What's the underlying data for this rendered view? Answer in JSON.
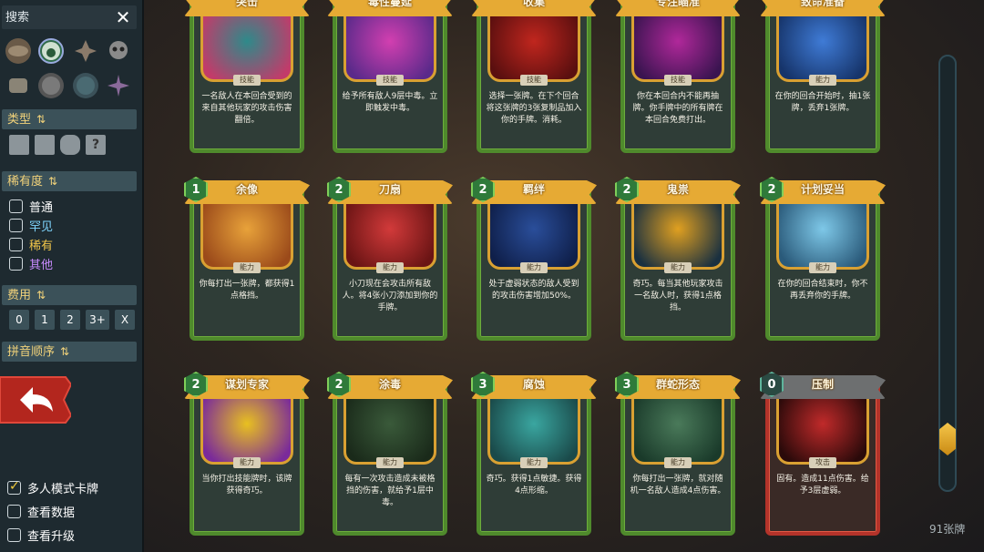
{
  "search": {
    "placeholder": "搜索"
  },
  "sections": {
    "type": "类型",
    "rarity": "稀有度",
    "cost": "费用",
    "pinyin": "拼音顺序"
  },
  "rarity_options": [
    {
      "label": "普通",
      "color": "#ffffff",
      "checked": false
    },
    {
      "label": "罕见",
      "color": "#7fd6ff",
      "checked": false
    },
    {
      "label": "稀有",
      "color": "#f2c64a",
      "checked": false
    },
    {
      "label": "其他",
      "color": "#c98bff",
      "checked": false
    }
  ],
  "cost_filters": [
    "0",
    "1",
    "2",
    "3+",
    "X"
  ],
  "bottom_options": [
    {
      "label": "多人模式卡牌",
      "checked": true
    },
    {
      "label": "查看数据",
      "checked": false
    },
    {
      "label": "查看升级",
      "checked": false
    }
  ],
  "card_count": "91张牌",
  "cards_row1": [
    {
      "title": "突击",
      "cost": "",
      "type": "技能",
      "desc": "一名敌人在本回合受到的来自其他玩家的攻击伤害翻倍。",
      "art": [
        "#2e8a8a",
        "#c23b6a"
      ]
    },
    {
      "title": "毒性蔓延",
      "cost": "",
      "type": "技能",
      "desc": "给予所有敌人9层中毒。立即触发中毒。",
      "art": [
        "#d23fb0",
        "#5a2a8a"
      ]
    },
    {
      "title": "收集",
      "cost": "",
      "type": "技能",
      "desc": "选择一张牌。在下个回合将这张牌的3张复制品加入你的手牌。消耗。",
      "art": [
        "#c0261e",
        "#5a0f0f"
      ]
    },
    {
      "title": "专注瞄准",
      "cost": "",
      "type": "技能",
      "desc": "你在本回合内不能再抽牌。你手牌中的所有牌在本回合免费打出。",
      "art": [
        "#b0289a",
        "#3a1450"
      ]
    },
    {
      "title": "致命准备",
      "cost": "",
      "type": "能力",
      "desc": "在你的回合开始时，抽1张牌，丢弃1张牌。",
      "art": [
        "#3f7bd6",
        "#16346a"
      ]
    }
  ],
  "cards_row2": [
    {
      "title": "余像",
      "cost": "1",
      "type": "能力",
      "desc": "你每打出一张牌，都获得1点格挡。",
      "art": [
        "#e8a23a",
        "#9b4a1a"
      ]
    },
    {
      "title": "刀扇",
      "cost": "2",
      "type": "能力",
      "desc": "小刀现在会攻击所有敌人。将4张小刀添加到你的手牌。",
      "art": [
        "#d23a3a",
        "#6a1414"
      ]
    },
    {
      "title": "羁绊",
      "cost": "2",
      "type": "能力",
      "desc": "处于虚弱状态的敌人受到的攻击伤害增加50%。",
      "art": [
        "#2a4e9a",
        "#0f1f4a"
      ]
    },
    {
      "title": "鬼祟",
      "cost": "2",
      "type": "能力",
      "desc": "奇巧。每当其他玩家攻击一名敌人时，获得1点格挡。",
      "art": [
        "#e0a020",
        "#1a3040"
      ]
    },
    {
      "title": "计划妥当",
      "cost": "2",
      "type": "能力",
      "desc": "在你的回合结束时，你不再丢弃你的手牌。",
      "art": [
        "#7ec8e8",
        "#2a5a7a"
      ]
    }
  ],
  "cards_row3": [
    {
      "title": "谋划专家",
      "cost": "2",
      "type": "能力",
      "desc": "当你打出技能牌时，该牌获得奇巧。",
      "art": [
        "#e8c020",
        "#7a2a9a"
      ]
    },
    {
      "title": "涂毒",
      "cost": "2",
      "type": "能力",
      "desc": "每有一次攻击造成未被格挡的伤害，就给予1层中毒。",
      "art": [
        "#3a5a3a",
        "#1a2a1a"
      ]
    },
    {
      "title": "腐蚀",
      "cost": "3",
      "type": "能力",
      "desc": "奇巧。获得1点敏捷。获得4点形缩。",
      "art": [
        "#3aa6a0",
        "#1a4a4a"
      ]
    },
    {
      "title": "群蛇形态",
      "cost": "3",
      "type": "能力",
      "desc": "你每打出一张牌，就对随机一名敌人造成4点伤害。",
      "art": [
        "#4a7a5a",
        "#1a3a2a"
      ]
    },
    {
      "title": "压制",
      "cost": "0",
      "type": "攻击",
      "desc": "固有。造成11点伤害。给予3层虚弱。",
      "art": [
        "#c02a2a",
        "#2a0a0a"
      ]
    }
  ],
  "colors": {
    "accent": "#f1d27a",
    "card_border": "#4f8a2c",
    "banner": "#e6aa34",
    "back_button": "#c0392b"
  },
  "icons": {
    "back": "undo-arrow-icon",
    "sort": "sort-arrows-icon",
    "close": "close-icon"
  }
}
